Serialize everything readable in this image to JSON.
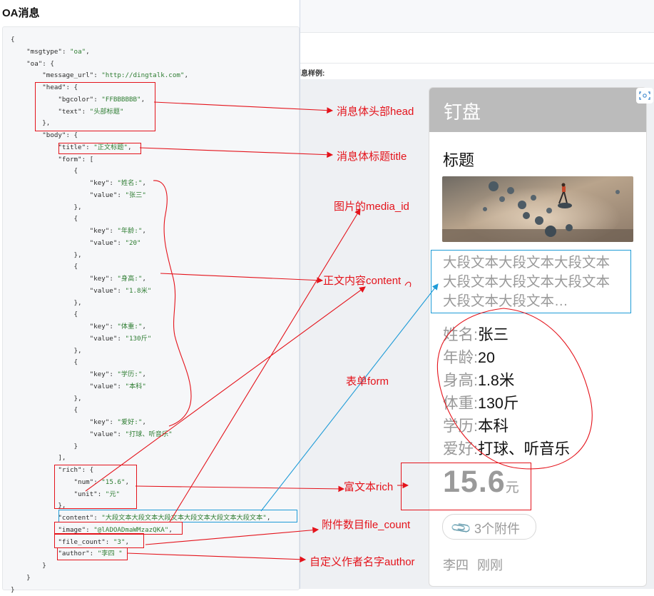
{
  "page": {
    "title": "OA消息",
    "sample_label": "消息样例:"
  },
  "code_lines": [
    "{",
    "    \"msgtype\": \"oa\",",
    "    \"oa\": {",
    "        \"message_url\": \"http://dingtalk.com\",",
    "        \"head\": {",
    "            \"bgcolor\": \"FFBBBBBB\",",
    "            \"text\": \"头部标题\"",
    "        },",
    "        \"body\": {",
    "            \"title\": \"正文标题\",",
    "            \"form\": [",
    "                {",
    "                    \"key\": \"姓名:\",",
    "                    \"value\": \"张三\"",
    "                },",
    "                {",
    "                    \"key\": \"年龄:\",",
    "                    \"value\": \"20\"",
    "                },",
    "                {",
    "                    \"key\": \"身高:\",",
    "                    \"value\": \"1.8米\"",
    "                },",
    "                {",
    "                    \"key\": \"体重:\",",
    "                    \"value\": \"130斤\"",
    "                },",
    "                {",
    "                    \"key\": \"学历:\",",
    "                    \"value\": \"本科\"",
    "                },",
    "                {",
    "                    \"key\": \"爱好:\",",
    "                    \"value\": \"打球、听音乐\"",
    "                }",
    "            ],",
    "            \"rich\": {",
    "                \"num\": \"15.6\",",
    "                \"unit\": \"元\"",
    "            },",
    "            \"content\": \"大段文本大段文本大段文本大段文本大段文本大段文本\",",
    "            \"image\": \"@lADOADmaWMzazQKA\",",
    "            \"file_count\": \"3\",",
    "            \"author\": \"李四 \"",
    "        }",
    "    }",
    "}"
  ],
  "card": {
    "head_text": "钉盘",
    "head_bgcolor": "#BBBBBB",
    "title": "标题",
    "content": "大段文本大段文本大段文本大段文本大段文本大段文本大段文本大段文本…",
    "form": [
      {
        "key": "姓名:",
        "value": "张三"
      },
      {
        "key": "年龄:",
        "value": "20"
      },
      {
        "key": "身高:",
        "value": "1.8米"
      },
      {
        "key": "体重:",
        "value": "130斤"
      },
      {
        "key": "学历:",
        "value": "本科"
      },
      {
        "key": "爱好:",
        "value": "打球、听音乐"
      }
    ],
    "rich_num": "15.6",
    "rich_unit": "元",
    "file_label": "3个附件",
    "author": "李四",
    "time": "刚刚"
  },
  "annotations": {
    "head": "消息体头部head",
    "title": "消息体标题title",
    "image": "图片的media_id",
    "content": "正文内容content",
    "form": "表单form",
    "rich": "富文本rich",
    "file_count": "附件数目file_count",
    "author": "自定义作者名字author"
  },
  "colors": {
    "annotation": "#e4131b",
    "content_box": "#1e9bd7"
  }
}
